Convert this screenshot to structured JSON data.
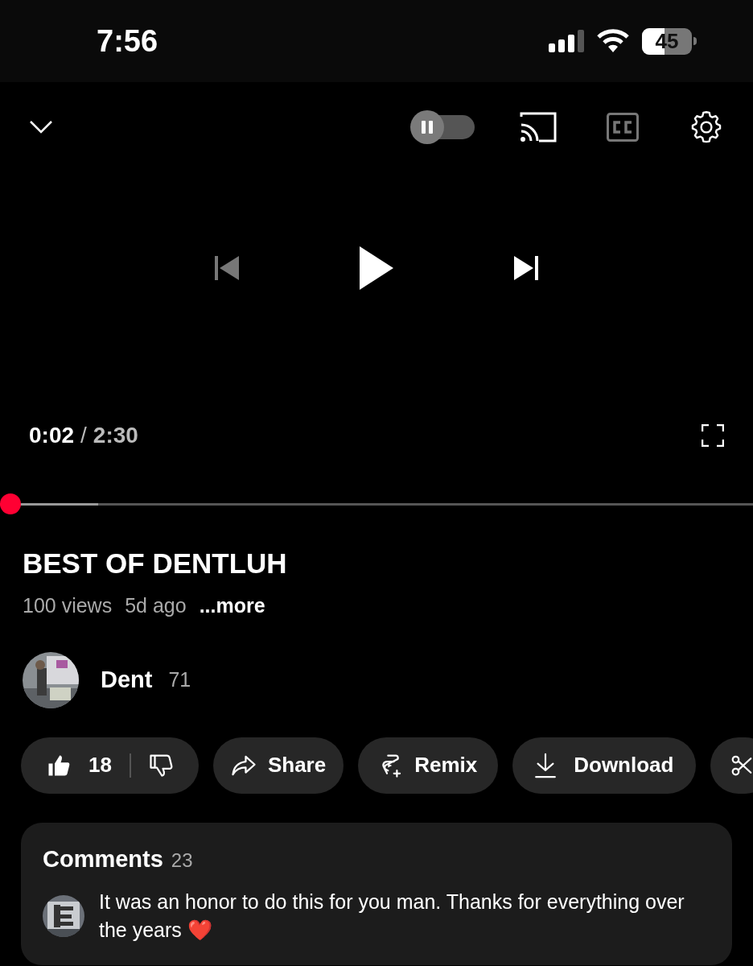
{
  "status_bar": {
    "time": "7:56",
    "battery": "45"
  },
  "player": {
    "autoplay": {
      "on": false
    },
    "captions": {
      "disabled": true
    },
    "current_time": "0:02",
    "separator": "/",
    "duration": "2:30",
    "progress": {
      "level": 0.013
    },
    "buffer": {
      "level": 0.13
    }
  },
  "video": {
    "title": "BEST OF DENTLUH",
    "views": "100 views",
    "age": "5d ago",
    "more": "...more"
  },
  "channel": {
    "name": "Dent",
    "subscribers": "71"
  },
  "actions": [
    {
      "kind": "like",
      "label": "18"
    },
    {
      "kind": "share",
      "label": "Share"
    },
    {
      "kind": "remix",
      "label": "Remix"
    },
    {
      "kind": "download",
      "label": "Download"
    },
    {
      "kind": "clip"
    }
  ],
  "comments": {
    "title": "Comments",
    "count": "23",
    "top_comment": {
      "text": "It was an honor to do this for you man. Thanks for everything over the years ❤️"
    }
  }
}
